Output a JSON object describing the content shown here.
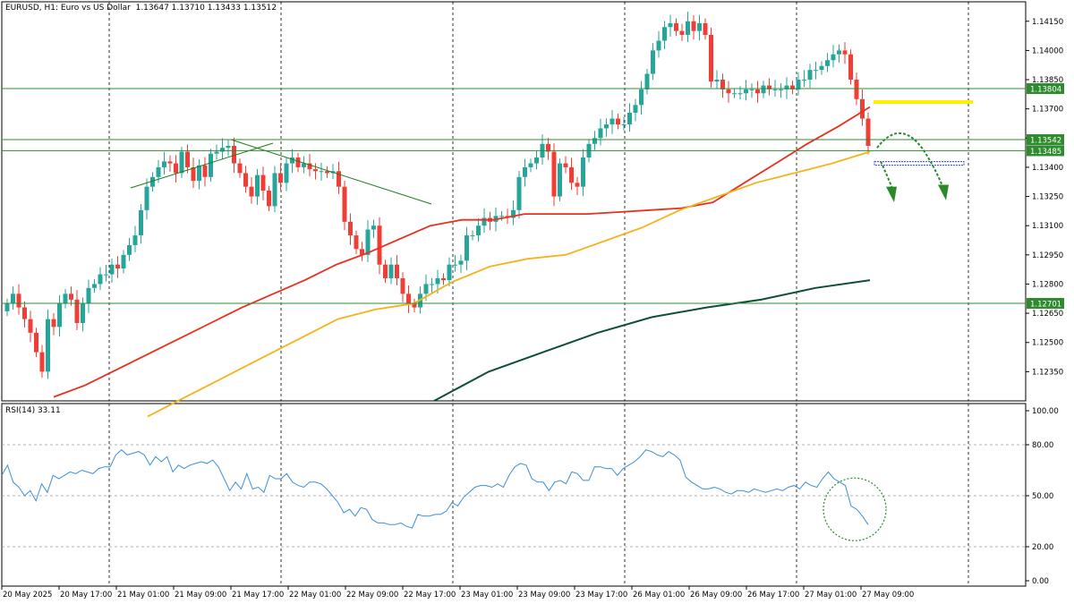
{
  "header": {
    "symbol": "EURUSD",
    "timeframe": "H1:",
    "description": "Euro vs US Dollar",
    "ohlc": "1.13647 1.13710 1.13433 1.13512"
  },
  "rsi_header": {
    "label": "RSI(14) 33.11"
  },
  "colors": {
    "bull": "#26a69a",
    "bear": "#ef3e36",
    "ma_fast": "#e8301e",
    "ma_mid": "#f7b21b",
    "ma_slow": "#0e4f3a",
    "hline": "#2e8b2e",
    "target": "#ffef00",
    "rsi": "#3a8fd8",
    "arrow": "#2a8a2a"
  },
  "chart_data": [
    {
      "type": "candlestick",
      "title": "EURUSD, H1: Euro vs US Dollar",
      "ylim": [
        1.122,
        1.1425
      ],
      "yticks": [
        "1.14150",
        "1.14000",
        "1.13850",
        "1.13700",
        "1.13550",
        "1.13400",
        "1.13250",
        "1.13100",
        "1.12950",
        "1.12800",
        "1.12650",
        "1.12500",
        "1.12350"
      ],
      "x_labels": [
        "20 May 2025",
        "20 May 17:00",
        "21 May 01:00",
        "21 May 09:00",
        "21 May 17:00",
        "22 May 01:00",
        "22 May 09:00",
        "22 May 17:00",
        "23 May 01:00",
        "23 May 09:00",
        "23 May 17:00",
        "26 May 01:00",
        "26 May 09:00",
        "26 May 17:00",
        "27 May 01:00",
        "27 May 09:00"
      ],
      "horizontal_levels": [
        {
          "label": "1.13804",
          "value": 1.13804
        },
        {
          "label": "1.13542",
          "value": 1.13542
        },
        {
          "label": "1.13485",
          "value": 1.13485
        },
        {
          "label": "1.12701",
          "value": 1.12701
        }
      ],
      "target_level": 1.13735,
      "support_zone": 1.1342,
      "close_series": [
        1.127,
        1.1275,
        1.1268,
        1.1262,
        1.1255,
        1.1245,
        1.1235,
        1.1262,
        1.1258,
        1.127,
        1.1275,
        1.1272,
        1.126,
        1.127,
        1.1278,
        1.128,
        1.1285,
        1.1285,
        1.129,
        1.1288,
        1.1295,
        1.13,
        1.1305,
        1.1318,
        1.133,
        1.1335,
        1.134,
        1.1343,
        1.1342,
        1.1337,
        1.1348,
        1.134,
        1.1333,
        1.1341,
        1.1335,
        1.1347,
        1.1348,
        1.135,
        1.1351,
        1.1342,
        1.1337,
        1.133,
        1.1325,
        1.1336,
        1.1328,
        1.132,
        1.1337,
        1.1332,
        1.1342,
        1.1345,
        1.134,
        1.1342,
        1.1339,
        1.1338,
        1.1338,
        1.1337,
        1.1338,
        1.133,
        1.1312,
        1.1305,
        1.1298,
        1.1295,
        1.1308,
        1.131,
        1.129,
        1.1283,
        1.129,
        1.1283,
        1.1275,
        1.127,
        1.1268,
        1.1275,
        1.128,
        1.128,
        1.1283,
        1.1282,
        1.129,
        1.129,
        1.1292,
        1.1305,
        1.1305,
        1.131,
        1.1314,
        1.1312,
        1.1315,
        1.1315,
        1.1314,
        1.1318,
        1.1335,
        1.134,
        1.1342,
        1.1345,
        1.1352,
        1.1348,
        1.1325,
        1.1342,
        1.134,
        1.1332,
        1.133,
        1.1345,
        1.1352,
        1.1355,
        1.136,
        1.1362,
        1.1365,
        1.1362,
        1.1362,
        1.1368,
        1.1372,
        1.138,
        1.1388,
        1.14,
        1.1405,
        1.1412,
        1.1414,
        1.141,
        1.1408,
        1.1415,
        1.141,
        1.1414,
        1.1408,
        1.1384,
        1.1385,
        1.138,
        1.1378,
        1.1378,
        1.1378,
        1.138,
        1.138,
        1.1378,
        1.1382,
        1.138,
        1.138,
        1.138,
        1.1382,
        1.138,
        1.1385,
        1.1385,
        1.139,
        1.139,
        1.1392,
        1.1395,
        1.1398,
        1.14,
        1.1398,
        1.1385,
        1.1375,
        1.1365,
        1.1351
      ],
      "series": [
        {
          "name": "MA fast",
          "values": [
            1.1222,
            1.1228,
            1.1236,
            1.1244,
            1.1252,
            1.126,
            1.1268,
            1.1275,
            1.1282,
            1.129,
            1.1296,
            1.1303,
            1.131,
            1.1313,
            1.1313,
            1.1316,
            1.1316,
            1.1316,
            1.1317,
            1.1318,
            1.1319,
            1.1322,
            1.1332,
            1.1342,
            1.1352,
            1.1361,
            1.1371
          ]
        },
        {
          "name": "MA mid",
          "values": [
            1.1212,
            1.1222,
            1.1232,
            1.1242,
            1.1252,
            1.1262,
            1.1267,
            1.127,
            1.1281,
            1.1289,
            1.1293,
            1.1295,
            1.1302,
            1.1309,
            1.1318,
            1.1325,
            1.1332,
            1.1337,
            1.1342,
            1.1348
          ]
        },
        {
          "name": "MA slow",
          "values": [
            1.122,
            1.1235,
            1.1245,
            1.1255,
            1.1263,
            1.1268,
            1.1272,
            1.1278,
            1.1282
          ]
        }
      ]
    },
    {
      "type": "line",
      "title": "RSI(14) 33.11",
      "ylim": [
        0,
        100
      ],
      "yticks": [
        "100.00",
        "80.00",
        "50.00",
        "20.00",
        "0.00"
      ],
      "levels": [
        80,
        50,
        20
      ],
      "values": [
        62,
        68,
        58,
        55,
        50,
        53,
        47,
        57,
        52,
        62,
        60,
        62,
        64,
        63,
        65,
        64,
        63,
        66,
        67,
        67,
        74,
        77,
        74,
        75,
        76,
        74,
        68,
        73,
        70,
        73,
        64,
        68,
        66,
        68,
        69,
        70,
        69,
        71,
        67,
        60,
        53,
        58,
        54,
        63,
        54,
        55,
        52,
        62,
        60,
        60,
        63,
        58,
        56,
        55,
        58,
        58,
        57,
        54,
        50,
        46,
        40,
        42,
        38,
        43,
        42,
        36,
        34,
        34,
        33,
        33,
        34,
        32,
        31,
        39,
        38,
        38,
        39,
        39,
        41,
        46,
        44,
        49,
        52,
        55,
        56,
        56,
        55,
        57,
        55,
        62,
        67,
        69,
        68,
        60,
        58,
        58,
        53,
        58,
        59,
        57,
        64,
        63,
        59,
        59,
        67,
        67,
        66,
        66,
        62,
        66,
        68,
        70,
        73,
        77,
        76,
        74,
        73,
        76,
        74,
        71,
        61,
        58,
        56,
        54,
        54,
        55,
        54,
        52,
        51,
        53,
        53,
        52,
        54,
        53,
        52,
        53,
        54,
        53,
        55,
        56,
        54,
        58,
        56,
        55,
        60,
        64,
        60,
        58,
        56,
        44,
        42,
        38,
        33
      ],
      "annotation": "circle around latest RSI readings"
    }
  ]
}
